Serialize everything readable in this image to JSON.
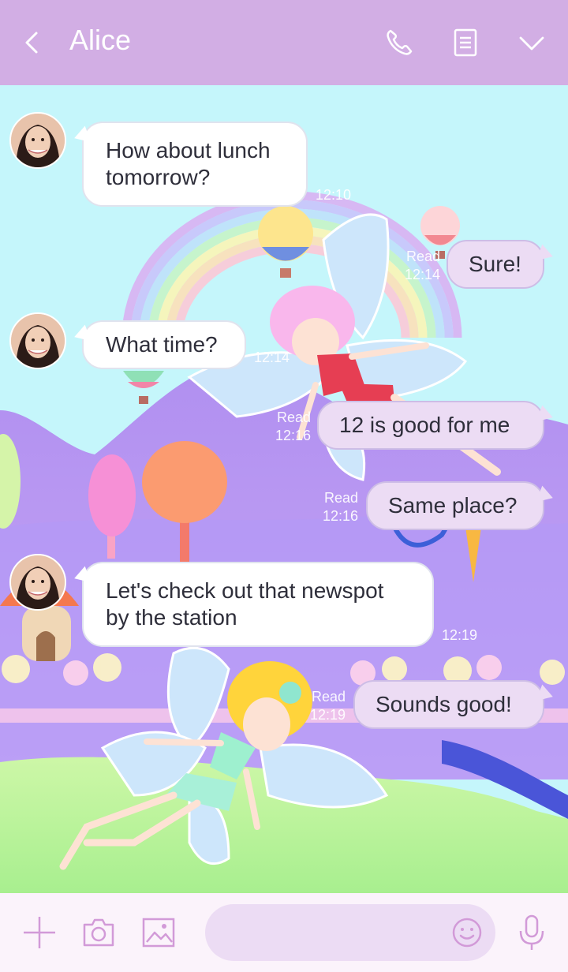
{
  "header": {
    "contact_name": "Alice",
    "icons": [
      "back-chevron-icon",
      "phone-icon",
      "notes-icon",
      "chevron-down-icon"
    ]
  },
  "messages": [
    {
      "direction": "incoming",
      "text": "How about lunch tomorrow?",
      "time": "12:10"
    },
    {
      "direction": "outgoing",
      "text": "Sure!",
      "read": "Read",
      "time": "12:14"
    },
    {
      "direction": "incoming",
      "text": "What time?",
      "time": "12:14"
    },
    {
      "direction": "outgoing",
      "text": "12 is good for me",
      "read": "Read",
      "time": "12:16"
    },
    {
      "direction": "outgoing",
      "text": "Same place?",
      "read": "Read",
      "time": "12:16"
    },
    {
      "direction": "incoming",
      "text": "Let's check out that newspot by the station",
      "time": "12:19"
    },
    {
      "direction": "outgoing",
      "text": "Sounds good!",
      "read": "Read",
      "time": "12:19"
    }
  ],
  "footer": {
    "input_value": "",
    "icons": [
      "plus-icon",
      "camera-icon",
      "image-icon",
      "smiley-icon",
      "microphone-icon"
    ]
  },
  "colors": {
    "header": "#d2aee4",
    "sky": "#c5f6fb",
    "outgoing_bubble": "#ecdcf4",
    "incoming_bubble": "#ffffff",
    "accent_icon": "#d29ad8"
  }
}
